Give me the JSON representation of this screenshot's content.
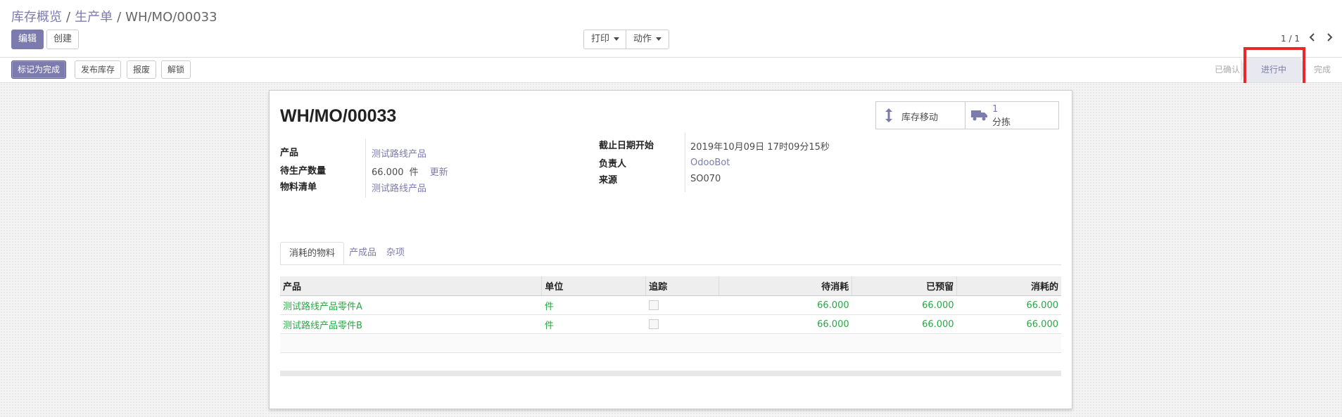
{
  "breadcrumb": {
    "items": [
      "库存概览",
      "生产单"
    ],
    "current": "WH/MO/00033"
  },
  "toolbar": {
    "edit_label": "编辑",
    "create_label": "创建",
    "print_label": "打印",
    "action_label": "动作"
  },
  "pager": {
    "value": "1 / 1"
  },
  "status_buttons": {
    "mark_done": "标记为完成",
    "post_inventory": "发布库存",
    "scrap": "报废",
    "unlock": "解锁"
  },
  "stages": {
    "confirmed": "已确认",
    "in_progress": "进行中",
    "done": "完成",
    "current": "进行中"
  },
  "record": {
    "title": "WH/MO/00033",
    "smart_buttons": {
      "stock_moves": "库存移动",
      "picking_count": "1",
      "picking_label": "分拣"
    },
    "left_fields": {
      "product_label": "产品",
      "product_value": "测试路线产品",
      "qty_label": "待生产数量",
      "qty_value": "66.000",
      "qty_unit": "件",
      "qty_update": "更新",
      "bom_label": "物料清单",
      "bom_value": "测试路线产品"
    },
    "right_fields": {
      "deadline_label": "截止日期开始",
      "deadline_value": "2019年10月09日 17时09分15秒",
      "responsible_label": "负责人",
      "responsible_value": "OdooBot",
      "source_label": "来源",
      "source_value": "SO070"
    }
  },
  "tabs": {
    "consumed": "消耗的物料",
    "produced": "产成品",
    "misc": "杂项",
    "active": "消耗的物料"
  },
  "table": {
    "headers": {
      "product": "产品",
      "unit": "单位",
      "tracking": "追踪",
      "to_consume": "待消耗",
      "reserved": "已预留",
      "consumed": "消耗的"
    },
    "rows": [
      {
        "product": "测试路线产品零件A",
        "unit": "件",
        "to_consume": "66.000",
        "reserved": "66.000",
        "consumed": "66.000"
      },
      {
        "product": "测试路线产品零件B",
        "unit": "件",
        "to_consume": "66.000",
        "reserved": "66.000",
        "consumed": "66.000"
      }
    ]
  },
  "colors": {
    "brand": "#7c7bad",
    "line_green": "#28a745",
    "highlight": "#e8282b"
  }
}
